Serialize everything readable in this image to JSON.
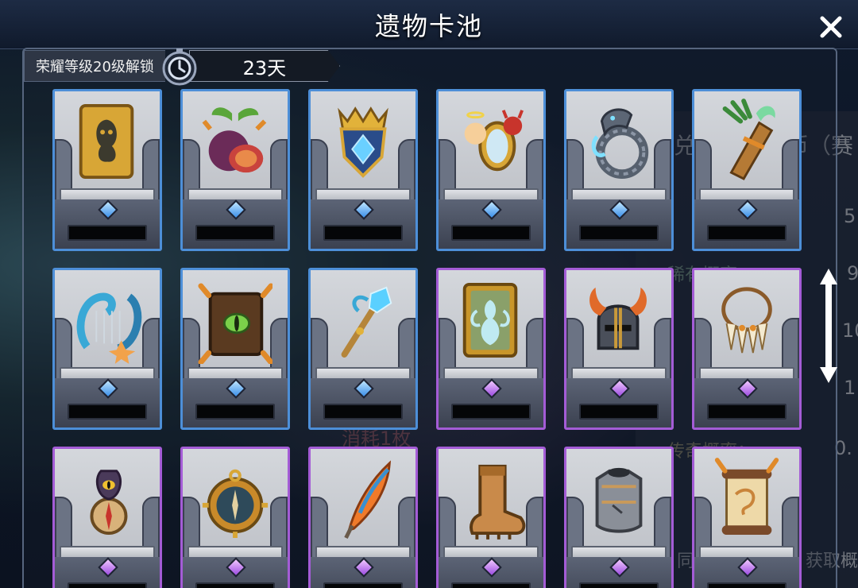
{
  "dialog": {
    "title": "遗物卡池",
    "close_icon": "close-icon",
    "unlock_label": "荣耀等级20级解锁",
    "timer_icon": "stopwatch-icon",
    "timer_value": "23天"
  },
  "background_fragments": {
    "right_header_partial": "兑",
    "right_header_partial_2": "币（赛",
    "right_values": [
      "5",
      "9",
      "10",
      "1",
      "0."
    ],
    "rarity_label": "稀有概率：",
    "legend_label": "传奇概率：",
    "consume_label": "消耗1枚",
    "footer_same": "同",
    "footer_obtain": "获取概"
  },
  "colors": {
    "rarity_blue": "#4d8fd8",
    "rarity_purple": "#a45cd6"
  },
  "cards": [
    {
      "icon": "ghost-tarot-card-icon",
      "rarity": "blue"
    },
    {
      "icon": "fig-fruit-icon",
      "rarity": "blue"
    },
    {
      "icon": "sapphire-crown-shield-icon",
      "rarity": "blue"
    },
    {
      "icon": "angel-devil-mirror-icon",
      "rarity": "blue"
    },
    {
      "icon": "ice-serpent-ring-icon",
      "rarity": "blue"
    },
    {
      "icon": "herb-quiver-icon",
      "rarity": "blue"
    },
    {
      "icon": "sea-lyre-icon",
      "rarity": "blue"
    },
    {
      "icon": "eye-tome-icon",
      "rarity": "blue"
    },
    {
      "icon": "crystal-staff-icon",
      "rarity": "blue"
    },
    {
      "icon": "spirit-tarot-card-icon",
      "rarity": "purple"
    },
    {
      "icon": "horned-helmet-icon",
      "rarity": "purple"
    },
    {
      "icon": "fang-necklace-icon",
      "rarity": "purple"
    },
    {
      "icon": "eye-compass-icon",
      "rarity": "purple"
    },
    {
      "icon": "spiked-compass-icon",
      "rarity": "purple"
    },
    {
      "icon": "phoenix-feather-icon",
      "rarity": "purple"
    },
    {
      "icon": "leather-boot-icon",
      "rarity": "purple"
    },
    {
      "icon": "iron-breastplate-icon",
      "rarity": "purple"
    },
    {
      "icon": "dragon-scroll-icon",
      "rarity": "purple"
    }
  ],
  "scroll": {
    "icon": "vertical-scroll-arrow-icon"
  }
}
